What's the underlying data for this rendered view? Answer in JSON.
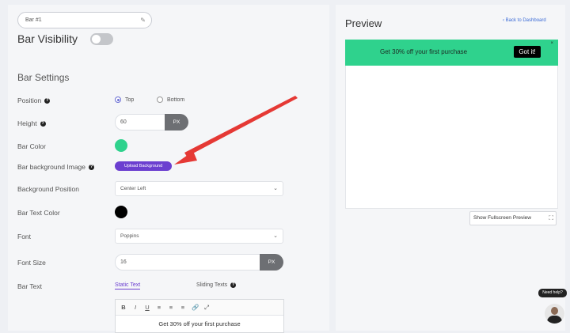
{
  "bar_name": "Bar #1",
  "bar_visibility": {
    "label": "Bar Visibility",
    "enabled": false
  },
  "settings": {
    "title": "Bar Settings",
    "position": {
      "label": "Position",
      "options": [
        "Top",
        "Bottom"
      ],
      "selected": "Top"
    },
    "height": {
      "label": "Height",
      "value": "60",
      "unit": "PX"
    },
    "bar_color": {
      "label": "Bar Color",
      "color": "#2fd28d"
    },
    "bar_background_image": {
      "label": "Bar background Image",
      "button": "Upload Background"
    },
    "background_position": {
      "label": "Background Position",
      "value": "Center Left"
    },
    "bar_text_color": {
      "label": "Bar Text Color",
      "color": "#000000"
    },
    "font": {
      "label": "Font",
      "value": "Poppins"
    },
    "font_size": {
      "label": "Font Size",
      "value": "16",
      "unit": "PX"
    },
    "bar_text": {
      "label": "Bar Text",
      "tabs": [
        "Static Text",
        "Sliding Texts"
      ],
      "active_tab": "Static Text",
      "toolbar": [
        "B",
        "I",
        "U",
        "≡",
        "≡",
        "≡",
        "🔗",
        "⤢"
      ],
      "content": "Get 30% off your first purchase"
    }
  },
  "preview": {
    "title": "Preview",
    "back_link": "Back to Dashboard",
    "bar_message": "Get 30% off your first purchase",
    "button_label": "Got it!",
    "close": "×",
    "fullscreen_label": "Show Fullscreen Preview"
  },
  "help": {
    "label": "Need help?"
  },
  "colors": {
    "accent": "#6b3fd0",
    "bar": "#2fd28d",
    "arrow": "#e53935"
  }
}
